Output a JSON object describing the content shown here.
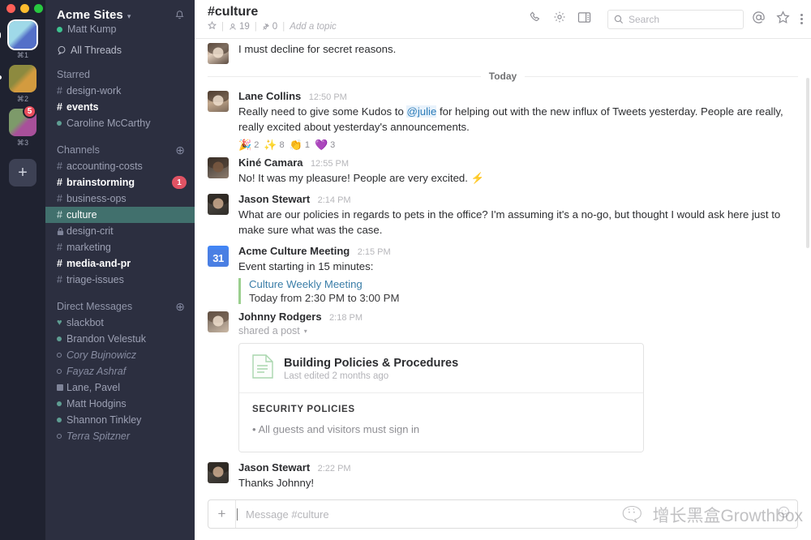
{
  "window": {
    "traffic_lights": [
      "#ff5f57",
      "#febc2e",
      "#28c840"
    ]
  },
  "rail": {
    "workspaces": [
      {
        "key": "⌘1",
        "badge": null,
        "state": "active",
        "gradient": [
          "#9fd9e8",
          "#5470c8"
        ]
      },
      {
        "key": "⌘2",
        "badge": null,
        "state": "unread",
        "gradient": [
          "#8d8a3f",
          "#d39b3f"
        ]
      },
      {
        "key": "⌘3",
        "badge": "5",
        "state": "normal",
        "gradient": [
          "#7d9a6a",
          "#a8509a"
        ]
      }
    ],
    "add_label": "+"
  },
  "sidebar": {
    "team_name": "Acme Sites",
    "team_caret": "▾",
    "user_name": "Matt Kump",
    "user_presence": "online",
    "all_threads_label": "All Threads",
    "sections": [
      {
        "title": "Starred",
        "has_add": false,
        "items": [
          {
            "sigil": "#",
            "label": "design-work",
            "state": "read"
          },
          {
            "sigil": "#",
            "label": "events",
            "state": "unread"
          },
          {
            "sigil": "•",
            "label": "Caroline McCarthy",
            "state": "read",
            "kind": "dm-online"
          }
        ]
      },
      {
        "title": "Channels",
        "has_add": true,
        "add_label": "⊕",
        "items": [
          {
            "sigil": "#",
            "label": "accounting-costs",
            "state": "read"
          },
          {
            "sigil": "#",
            "label": "brainstorming",
            "state": "unread",
            "badge": "1"
          },
          {
            "sigil": "#",
            "label": "business-ops",
            "state": "read"
          },
          {
            "sigil": "#",
            "label": "culture",
            "state": "selected"
          },
          {
            "sigil": "🔒",
            "label": "design-crit",
            "state": "read",
            "kind": "private"
          },
          {
            "sigil": "#",
            "label": "marketing",
            "state": "read"
          },
          {
            "sigil": "#",
            "label": "media-and-pr",
            "state": "unread"
          },
          {
            "sigil": "#",
            "label": "triage-issues",
            "state": "read"
          }
        ]
      },
      {
        "title": "Direct Messages",
        "has_add": true,
        "add_label": "⊕",
        "items": [
          {
            "sigil": "♥",
            "label": "slackbot",
            "state": "read",
            "kind": "bot-online"
          },
          {
            "sigil": "•",
            "label": "Brandon Velestuk",
            "state": "read",
            "kind": "dm-online"
          },
          {
            "sigil": "◦",
            "label": "Cory Bujnowicz",
            "state": "muted",
            "kind": "dm-away"
          },
          {
            "sigil": "◦",
            "label": "Fayaz Ashraf",
            "state": "muted",
            "kind": "dm-away"
          },
          {
            "sigil": "▣",
            "label": "Lane, Pavel",
            "state": "read",
            "kind": "group"
          },
          {
            "sigil": "•",
            "label": "Matt Hodgins",
            "state": "read",
            "kind": "dm-online"
          },
          {
            "sigil": "•",
            "label": "Shannon Tinkley",
            "state": "read",
            "kind": "dm-online"
          },
          {
            "sigil": "◦",
            "label": "Terra Spitzner",
            "state": "muted",
            "kind": "dm-away"
          }
        ]
      }
    ]
  },
  "channel_header": {
    "title": "#culture",
    "star_icon": "star-outline-icon",
    "member_count": "19",
    "pin_count": "0",
    "topic_placeholder": "Add a topic",
    "icons": [
      "phone-icon",
      "gear-icon",
      "split-panel-icon"
    ],
    "search_placeholder": "Search",
    "right_icons": [
      "mentions-icon",
      "star-icon",
      "kebab-menu-icon"
    ]
  },
  "messages": {
    "continued_top": {
      "text": "I must decline for secret reasons."
    },
    "day_divider": "Today",
    "items": [
      {
        "author": "Lane Collins",
        "time": "12:50 PM",
        "text_before": "Really need to give some Kudos to ",
        "mention": "@julie",
        "text_after": " for helping out with the new influx of Tweets yesterday. People are really, really excited about yesterday's announcements.",
        "reactions": [
          {
            "emoji": "🎉",
            "count": "2"
          },
          {
            "emoji": "✨",
            "count": "8"
          },
          {
            "emoji": "👏",
            "count": "1"
          },
          {
            "emoji": "💜",
            "count": "3"
          }
        ]
      },
      {
        "author": "Kiné Camara",
        "time": "12:55 PM",
        "text": "No! It was my pleasure! People are very excited. ⚡"
      },
      {
        "author": "Jason Stewart",
        "time": "2:14 PM",
        "text": "What are our policies in regards to pets in the office? I'm assuming it's a no-go, but thought I would ask here just to make sure what was the case."
      }
    ],
    "calendar_event": {
      "app_name": "Acme Culture Meeting",
      "time": "2:15 PM",
      "icon_day": "31",
      "text": "Event starting in 15 minutes:",
      "event_title": "Culture Weekly Meeting",
      "event_when": "Today from 2:30 PM to 3:00 PM"
    },
    "shared_post": {
      "author": "Johnny Rodgers",
      "time": "2:18 PM",
      "shared_label": "shared a post",
      "caret": "▾",
      "doc_title": "Building Policies & Procedures",
      "doc_sub": "Last edited 2 months ago",
      "section_heading": "SECURITY POLICIES",
      "bullet": "All guests and visitors must sign in"
    },
    "last": {
      "author": "Jason Stewart",
      "time": "2:22 PM",
      "text": "Thanks Johnny!"
    }
  },
  "composer": {
    "plus_label": "+",
    "placeholder": "Message #culture",
    "emoji_icon": "smiley-icon"
  },
  "watermark": {
    "text": "增长黑盒Growthbox"
  },
  "colors": {
    "sidebar_bg": "#2c2f40",
    "rail_bg": "#1f2230",
    "selected_channel": "#41706d",
    "badge_red": "#e05364",
    "link_blue": "#2c7cb8",
    "presence_green": "#3ec28f"
  }
}
